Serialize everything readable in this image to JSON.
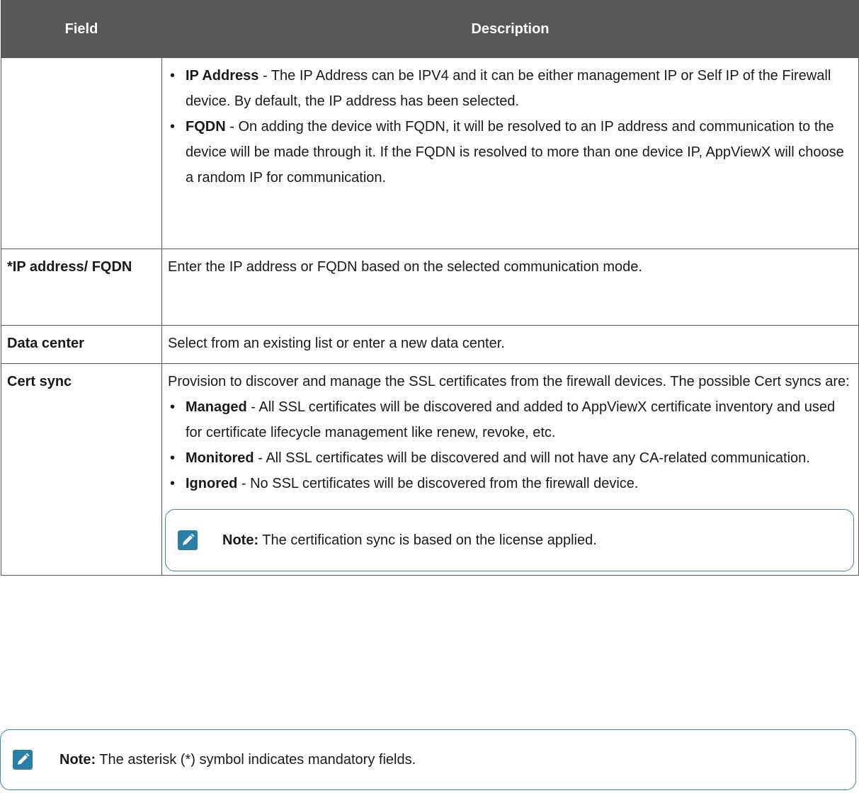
{
  "table": {
    "headers": {
      "field": "Field",
      "description": "Description"
    },
    "row1": {
      "field": "",
      "bullets": [
        {
          "term": "IP Address",
          "text": " - The IP Address can be IPV4 and it can be either management IP or Self IP of the Firewall device. By default, the IP address has been selected."
        },
        {
          "term": "FQDN",
          "text": " - On adding the device with FQDN, it will be resolved to an IP address and communication to the device will be made through it. If the FQDN is resolved to more than one device IP, AppViewX will choose a random IP for communication."
        }
      ]
    },
    "row2": {
      "field": "*IP address/ FQDN",
      "description": "Enter the IP address or FQDN based on the selected communication mode."
    },
    "row3": {
      "field": "Data center",
      "description": "Select from an existing list or enter a new data center."
    },
    "row4": {
      "field": "Cert sync",
      "intro": "Provision to discover and manage the SSL certificates from the firewall devices. The possible Cert syncs are:",
      "bullets": [
        {
          "term": "Managed",
          "text": " - All SSL certificates will be discovered and added to AppViewX certificate inventory and used for certificate lifecycle management like renew, revoke, etc."
        },
        {
          "term": "Monitored",
          "text": " - All SSL certificates will be discovered and will not have any CA-related communication."
        },
        {
          "term": "Ignored",
          "text": " - No SSL certificates will be discovered from the firewall device."
        }
      ],
      "note": {
        "label": "Note:",
        "text": " The certification sync is based on the license applied.",
        "icon": "pencil-note-icon"
      }
    }
  },
  "footer_note": {
    "label": "Note:",
    "text": " The asterisk (*) symbol indicates mandatory fields.",
    "icon": "pencil-note-icon"
  },
  "colors": {
    "header_bg": "#585858",
    "note_icon": "#2a7fa6",
    "note_border": "#3a88a6"
  },
  "bullet_char": "•"
}
